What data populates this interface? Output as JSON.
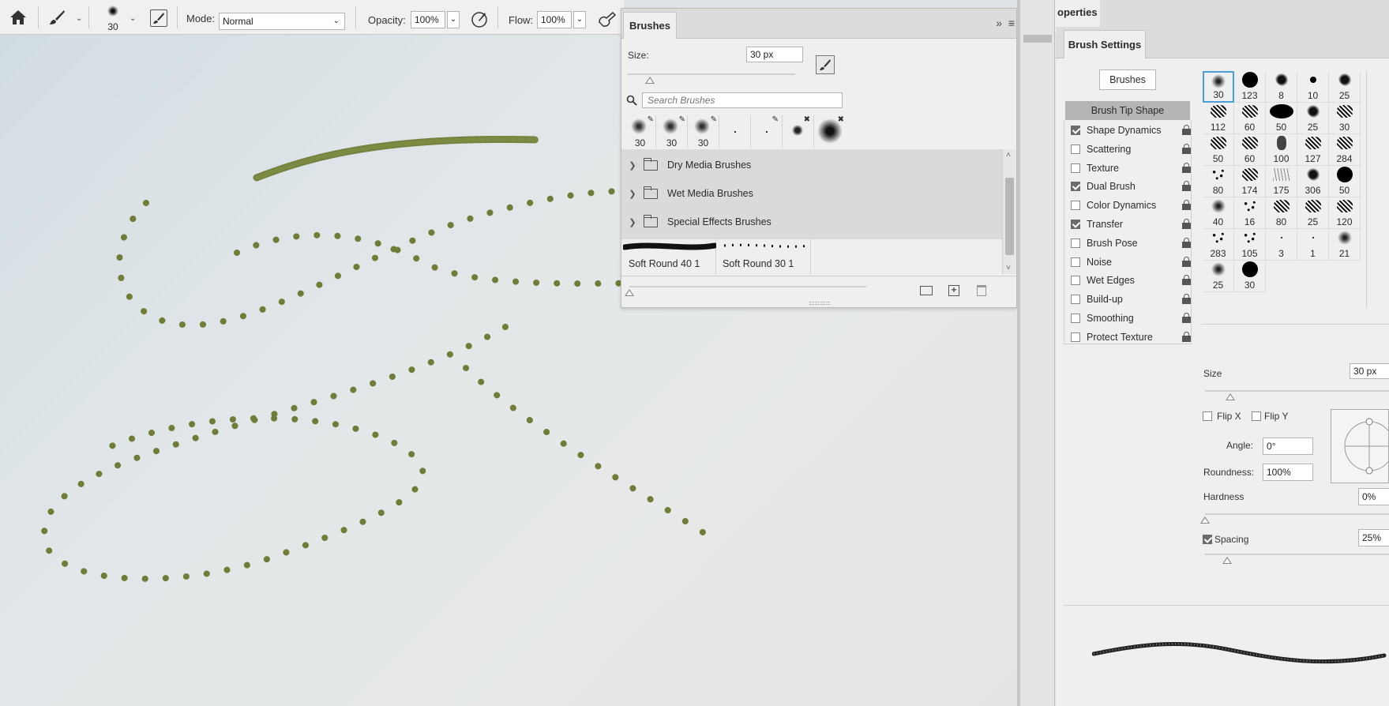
{
  "options_bar": {
    "brush_size": "30",
    "mode_label": "Mode:",
    "mode_value": "Normal",
    "opacity_label": "Opacity:",
    "opacity_value": "100%",
    "flow_label": "Flow:",
    "flow_value": "100%"
  },
  "brushes_panel": {
    "tab": "Brushes",
    "size_label": "Size:",
    "size_value": "30 px",
    "search_placeholder": "Search Brushes",
    "recent_sizes": [
      "30",
      "30",
      "30"
    ],
    "groups": [
      "Dry Media Brushes",
      "Wet Media Brushes",
      "Special Effects Brushes"
    ],
    "strokes": [
      "Soft Round 40 1",
      "Soft Round 30 1"
    ]
  },
  "properties_tab": "operties",
  "brush_settings": {
    "tab": "Brush Settings",
    "brushes_button": "Brushes",
    "tip_shape": "Brush Tip Shape",
    "categories": [
      {
        "label": "Shape Dynamics",
        "checked": true
      },
      {
        "label": "Scattering",
        "checked": false
      },
      {
        "label": "Texture",
        "checked": false
      },
      {
        "label": "Dual Brush",
        "checked": true
      },
      {
        "label": "Color Dynamics",
        "checked": false
      },
      {
        "label": "Transfer",
        "checked": true
      },
      {
        "label": "Brush Pose",
        "checked": false
      },
      {
        "label": "Noise",
        "checked": false
      },
      {
        "label": "Wet Edges",
        "checked": false
      },
      {
        "label": "Build-up",
        "checked": false
      },
      {
        "label": "Smoothing",
        "checked": false
      },
      {
        "label": "Protect Texture",
        "checked": false
      }
    ],
    "tips": [
      {
        "n": "30",
        "s": "soft"
      },
      {
        "n": "123",
        "s": "hard"
      },
      {
        "n": "8",
        "s": "splat"
      },
      {
        "n": "10",
        "s": "hard-small"
      },
      {
        "n": "25",
        "s": "splat"
      },
      {
        "n": "112",
        "s": "texture"
      },
      {
        "n": "60",
        "s": "texture"
      },
      {
        "n": "50",
        "s": "hard-wide"
      },
      {
        "n": "25",
        "s": "splat"
      },
      {
        "n": "30",
        "s": "texture"
      },
      {
        "n": "50",
        "s": "texture"
      },
      {
        "n": "60",
        "s": "texture"
      },
      {
        "n": "100",
        "s": "chalk"
      },
      {
        "n": "127",
        "s": "texture"
      },
      {
        "n": "284",
        "s": "texture"
      },
      {
        "n": "80",
        "s": "speckle"
      },
      {
        "n": "174",
        "s": "texture"
      },
      {
        "n": "175",
        "s": "grass"
      },
      {
        "n": "306",
        "s": "splat"
      },
      {
        "n": "50",
        "s": "hard"
      },
      {
        "n": "40",
        "s": "soft"
      },
      {
        "n": "16",
        "s": "speckle"
      },
      {
        "n": "80",
        "s": "texture"
      },
      {
        "n": "25",
        "s": "texture"
      },
      {
        "n": "120",
        "s": "texture"
      },
      {
        "n": "283",
        "s": "speckle"
      },
      {
        "n": "105",
        "s": "speckle"
      },
      {
        "n": "3",
        "s": "dot"
      },
      {
        "n": "1",
        "s": "dot"
      },
      {
        "n": "21",
        "s": "soft"
      },
      {
        "n": "25",
        "s": "soft"
      },
      {
        "n": "30",
        "s": "hard"
      }
    ],
    "size_label": "Size",
    "size_value": "30 px",
    "flip_x": "Flip X",
    "flip_y": "Flip Y",
    "angle_label": "Angle:",
    "angle_value": "0°",
    "roundness_label": "Roundness:",
    "roundness_value": "100%",
    "hardness_label": "Hardness",
    "hardness_value": "0%",
    "spacing_label": "Spacing",
    "spacing_value": "25%"
  },
  "colors": {
    "stroke": "#6f7d37",
    "panel": "#efefef",
    "selected": "#4a9fd8"
  }
}
